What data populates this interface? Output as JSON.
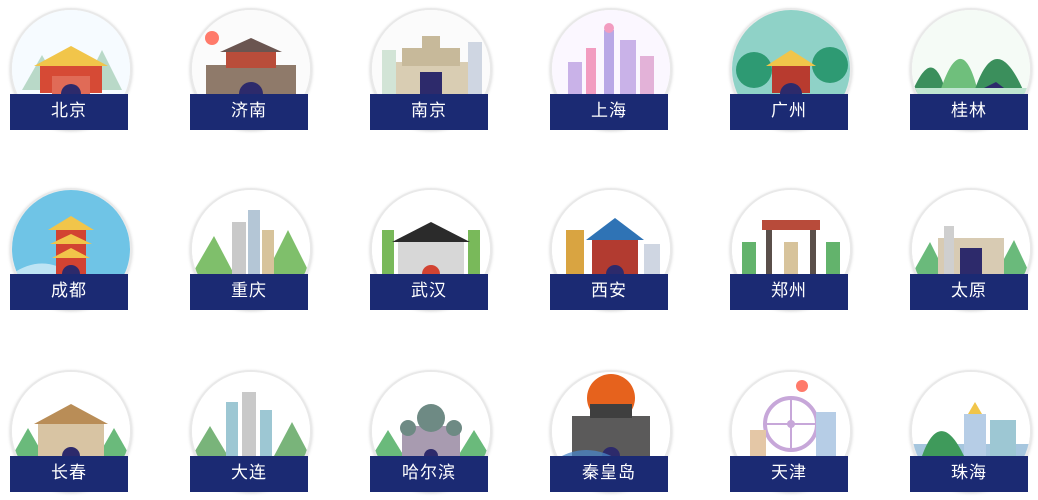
{
  "cities": [
    {
      "name": "北京",
      "sky": "#f6fbff",
      "accent": "#d64a35",
      "roof": "#f1c54a",
      "icon": "palace-icon"
    },
    {
      "name": "济南",
      "sky": "#fbfbfb",
      "accent": "#8f7a6a",
      "roof": "#b94d3a",
      "icon": "city-gate-icon"
    },
    {
      "name": "南京",
      "sky": "#fbfbfb",
      "accent": "#d9cdb3",
      "roof": "#c7b99a",
      "icon": "mausoleum-icon"
    },
    {
      "name": "上海",
      "sky": "#fbf7ff",
      "accent": "#c9b2e8",
      "roof": "#f29cc0",
      "icon": "skyline-icon"
    },
    {
      "name": "广州",
      "sky": "#8fd2c7",
      "accent": "#2e9a73",
      "roof": "#b83b2f",
      "icon": "pagoda-icon"
    },
    {
      "name": "桂林",
      "sky": "#f5fbf6",
      "accent": "#3b8f5c",
      "roof": "#6fbf7c",
      "icon": "karst-hills-icon"
    },
    {
      "name": "成都",
      "sky": "#6fc4e6",
      "accent": "#d24332",
      "roof": "#f1c54a",
      "icon": "tower-icon"
    },
    {
      "name": "重庆",
      "sky": "#ffffff",
      "accent": "#7fbf6b",
      "roof": "#c9c9c9",
      "icon": "towers-icon"
    },
    {
      "name": "武汉",
      "sky": "#ffffff",
      "accent": "#79b95a",
      "roof": "#2b2b2b",
      "icon": "yellow-crane-tower-icon"
    },
    {
      "name": "西安",
      "sky": "#ffffff",
      "accent": "#d9a441",
      "roof": "#2f73b5",
      "icon": "bell-tower-icon"
    },
    {
      "name": "郑州",
      "sky": "#ffffff",
      "accent": "#63b36c",
      "roof": "#b84b3a",
      "icon": "gate-arch-icon"
    },
    {
      "name": "太原",
      "sky": "#ffffff",
      "accent": "#d8cbb3",
      "roof": "#6aba7b",
      "icon": "museum-icon"
    },
    {
      "name": "长春",
      "sky": "#ffffff",
      "accent": "#d8c4a3",
      "roof": "#b98d57",
      "icon": "palace-building-icon"
    },
    {
      "name": "大连",
      "sky": "#ffffff",
      "accent": "#79b47a",
      "roof": "#9dc7d3",
      "icon": "modern-towers-icon"
    },
    {
      "name": "哈尔滨",
      "sky": "#ffffff",
      "accent": "#a89bb0",
      "roof": "#6e8a84",
      "icon": "cathedral-icon"
    },
    {
      "name": "秦皇岛",
      "sky": "#ffffff",
      "accent": "#e6621d",
      "roof": "#5b5a5a",
      "icon": "fortress-gate-icon"
    },
    {
      "name": "天津",
      "sky": "#ffffff",
      "accent": "#c7a7d9",
      "roof": "#b6cde6",
      "icon": "ferris-wheel-icon"
    },
    {
      "name": "珠海",
      "sky": "#ffffff",
      "accent": "#6aa0c8",
      "roof": "#3f9a5b",
      "icon": "coastline-icon"
    }
  ]
}
